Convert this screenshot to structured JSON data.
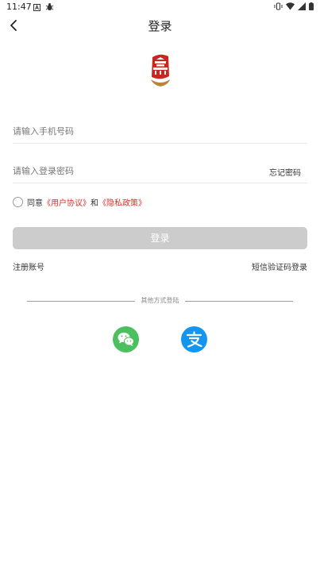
{
  "status_bar": {
    "time": "11:47",
    "left_icons": [
      "notification-a-icon",
      "bug-icon"
    ],
    "right_icons": [
      "vibrate-icon",
      "wifi-icon",
      "signal-icon",
      "battery-icon"
    ]
  },
  "nav": {
    "title": "登录",
    "back_icon": "chevron-left-icon"
  },
  "form": {
    "phone_placeholder": "请输入手机号码",
    "password_placeholder": "请输入登录密码",
    "forgot_password": "忘记密码",
    "agree_prefix": "同意",
    "user_agreement": "《用户协议》",
    "agree_and": "和",
    "privacy_policy": "《隐私政策》",
    "login_button": "登录",
    "register": "注册账号",
    "sms_login": "短信验证码登录"
  },
  "other_login": {
    "label": "其他方式登陆",
    "options": [
      "wechat-icon",
      "alipay-icon"
    ]
  },
  "colors": {
    "accent_red": "#d9302a",
    "button_disabled": "#cccccc",
    "wechat_green": "#4cbf5e",
    "alipay_blue": "#1296ef"
  }
}
